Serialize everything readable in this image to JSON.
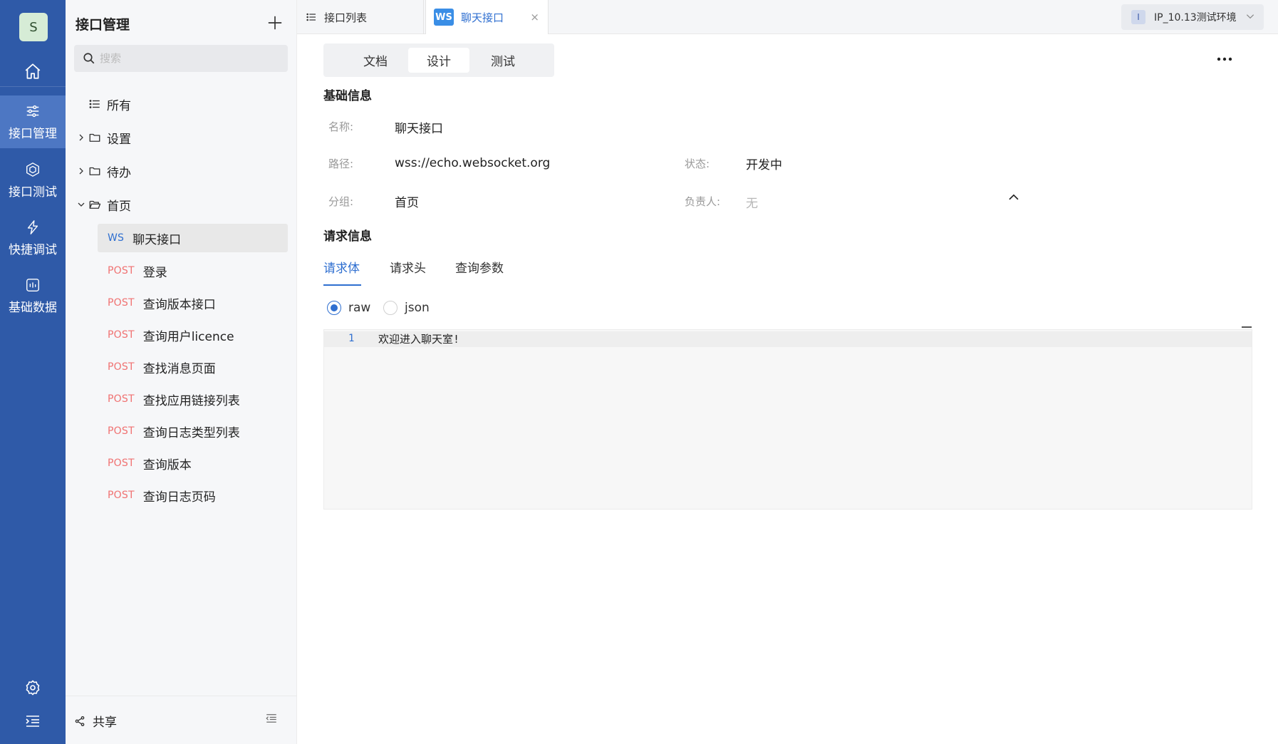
{
  "user": {
    "avatar_letter": "S"
  },
  "nav": {
    "items": [
      {
        "label": "接口管理",
        "icon": "sliders-icon",
        "active": true
      },
      {
        "label": "接口测试",
        "icon": "cube-icon",
        "active": false
      },
      {
        "label": "快捷调试",
        "icon": "bolt-icon",
        "active": false
      },
      {
        "label": "基础数据",
        "icon": "chart-box-icon",
        "active": false
      }
    ]
  },
  "sidebar": {
    "title": "接口管理",
    "search_placeholder": "搜索",
    "all_label": "所有",
    "folders": [
      {
        "label": "设置",
        "expanded": false
      },
      {
        "label": "待办",
        "expanded": false
      },
      {
        "label": "首页",
        "expanded": true
      }
    ],
    "apis": [
      {
        "method": "WS",
        "label": "聊天接口",
        "selected": true
      },
      {
        "method": "POST",
        "label": "登录"
      },
      {
        "method": "POST",
        "label": "查询版本接口"
      },
      {
        "method": "POST",
        "label": "查询用户licence"
      },
      {
        "method": "POST",
        "label": "查找消息页面"
      },
      {
        "method": "POST",
        "label": "查找应用链接列表"
      },
      {
        "method": "POST",
        "label": "查询日志类型列表"
      },
      {
        "method": "POST",
        "label": "查询版本"
      },
      {
        "method": "POST",
        "label": "查询日志页码"
      }
    ],
    "footer_share": "共享"
  },
  "tabs": {
    "list_tab": "接口列表",
    "active_badge": "WS",
    "active_tab": "聊天接口",
    "close_symbol": "×"
  },
  "env": {
    "badge": "I",
    "name": "IP_10.13测试环境"
  },
  "segments": {
    "doc": "文档",
    "design": "设计",
    "test": "测试"
  },
  "basic": {
    "title": "基础信息",
    "name_label": "名称:",
    "name_value": "聊天接口",
    "path_label": "路径:",
    "path_value": "wss://echo.websocket.org",
    "status_label": "状态:",
    "status_value": "开发中",
    "group_label": "分组:",
    "group_value": "首页",
    "owner_label": "负责人:",
    "owner_value": "无"
  },
  "request": {
    "title": "请求信息",
    "tabs": [
      "请求体",
      "请求头",
      "查询参数"
    ],
    "radio_raw": "raw",
    "radio_json": "json",
    "line_number": "1",
    "code": "欢迎进入聊天室!"
  },
  "colors": {
    "nav_bg": "#2f5aa8",
    "accent": "#2f6fd0",
    "post": "#f07272"
  }
}
